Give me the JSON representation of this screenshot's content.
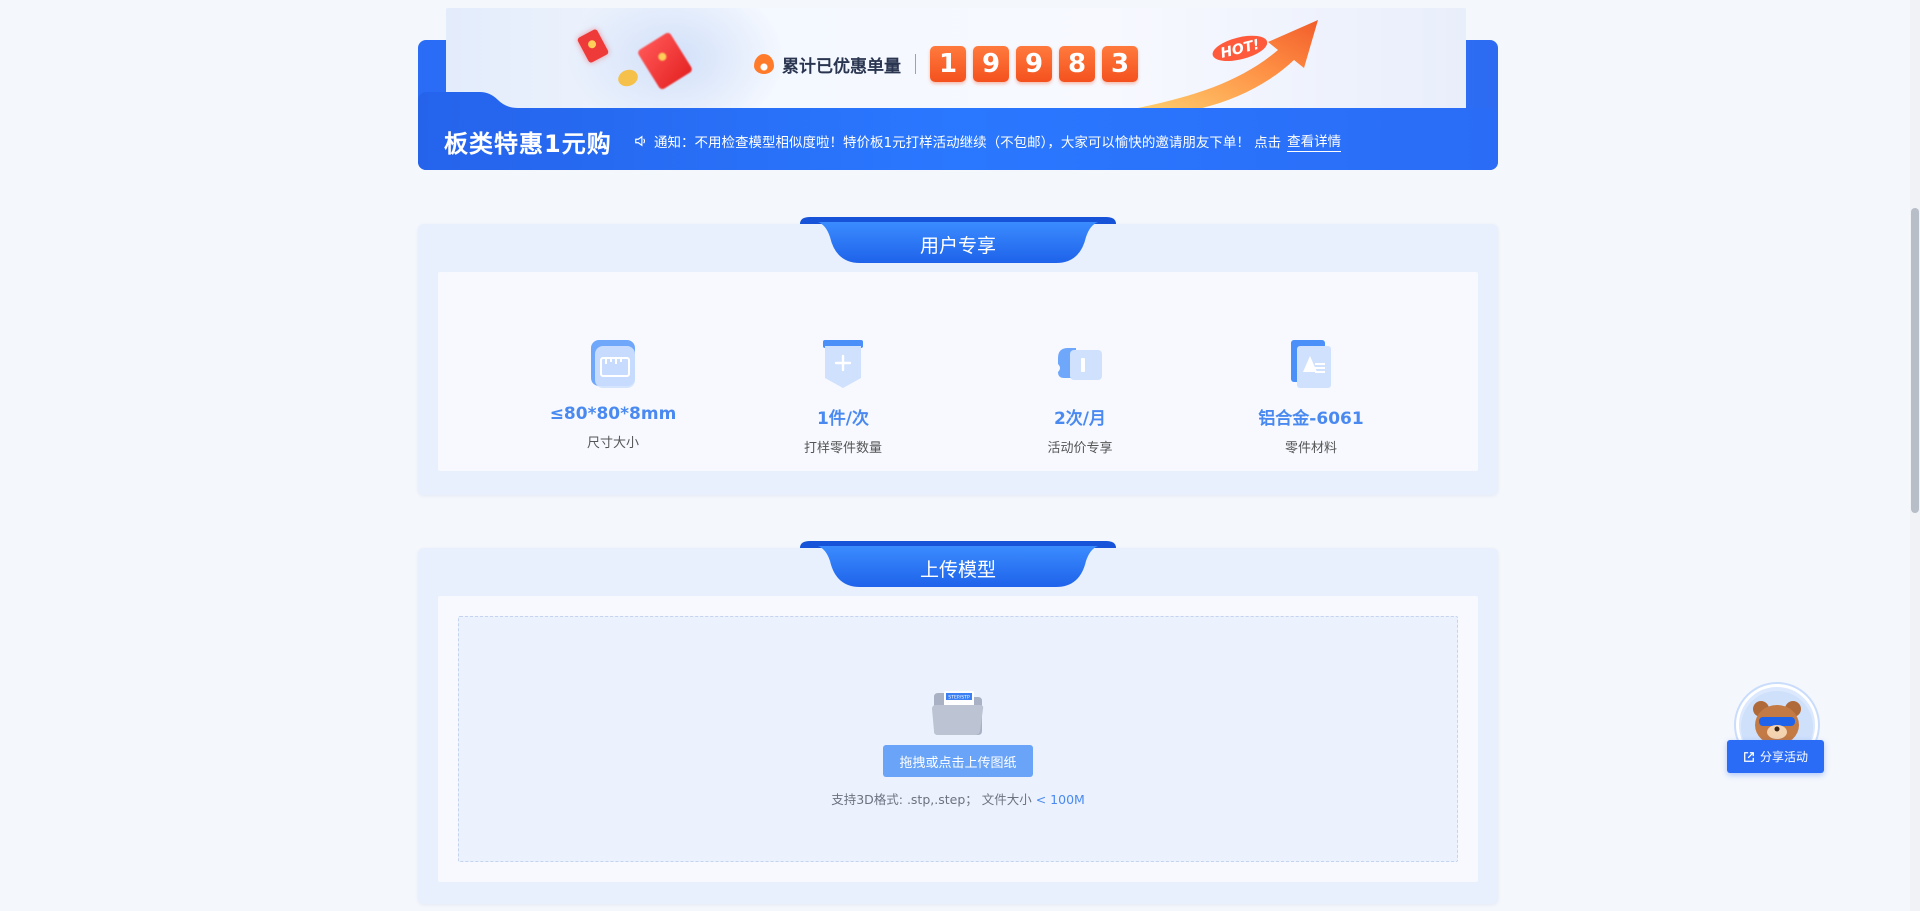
{
  "banner": {
    "counter_label": "累计已优惠单量",
    "counter_digits": [
      "1",
      "9",
      "9",
      "8",
      "3"
    ],
    "hot_badge": "HOT!",
    "promo_title": "板类特惠1元购",
    "notice_text": "通知：不用检查模型相似度啦！特价板1元打样活动继续（不包邮），大家可以愉快的邀请朋友下单！ 点击",
    "notice_link": "查看详情"
  },
  "user_exclusive": {
    "title": "用户专享",
    "perks": [
      {
        "value": "≤80*80*8mm",
        "label": "尺寸大小",
        "icon": "ruler-icon"
      },
      {
        "value": "1件/次",
        "label": "打样零件数量",
        "icon": "part-add-icon"
      },
      {
        "value": "2次/月",
        "label": "活动价专享",
        "icon": "ticket-icon"
      },
      {
        "value": "铝合金-6061",
        "label": "零件材料",
        "icon": "material-icon"
      }
    ]
  },
  "upload": {
    "title": "上传模型",
    "button_label": "拖拽或点击上传图纸",
    "hint_text": "支持3D格式: .stp,.step；  文件大小 ",
    "hint_limit": "< 100M",
    "folder_tag": "STEP/STP"
  },
  "share": {
    "button_label": "分享活动"
  },
  "colors": {
    "primary": "#2a6cf6",
    "accent_orange": "#f4511e",
    "perk_value": "#4a8af0"
  }
}
